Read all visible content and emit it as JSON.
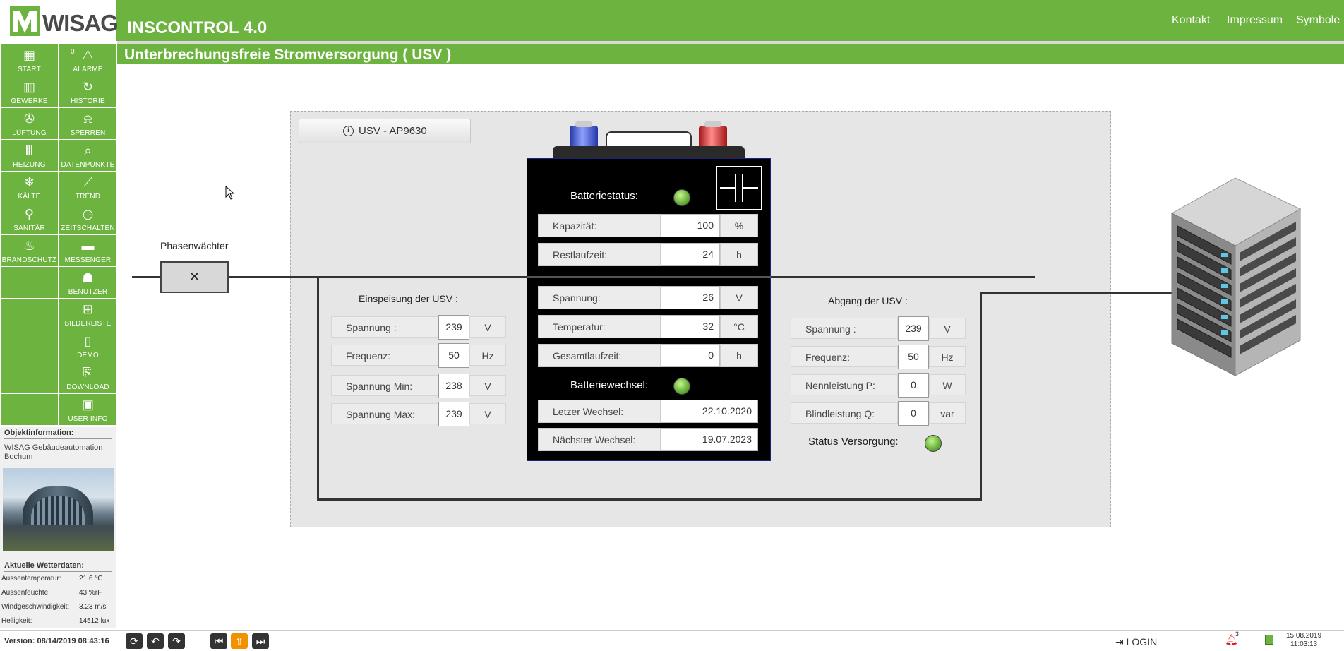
{
  "header": {
    "logo_text": "WISAG",
    "app_title": "INSCONTROL 4.0",
    "links": [
      "Kontakt",
      "Impressum",
      "Symbole"
    ]
  },
  "page_title": "Unterbrechungsfreie Stromversorgung ( USV )",
  "nav": {
    "left": [
      {
        "label": "START",
        "icon": "grid-icon"
      },
      {
        "label": "GEWERKE",
        "icon": "building-icon"
      },
      {
        "label": "LÜFTUNG",
        "icon": "fan-icon"
      },
      {
        "label": "HEIZUNG",
        "icon": "radiator-icon"
      },
      {
        "label": "KÄLTE",
        "icon": "snowflake-icon"
      },
      {
        "label": "SANITÄR",
        "icon": "faucet-icon"
      },
      {
        "label": "BRANDSCHUTZ",
        "icon": "flame-icon"
      }
    ],
    "right": [
      {
        "label": "ALARME",
        "icon": "alarm-icon"
      },
      {
        "label": "HISTORIE",
        "icon": "history-icon"
      },
      {
        "label": "SPERREN",
        "icon": "bell-off-icon"
      },
      {
        "label": "DATENPUNKTE",
        "icon": "search-chart-icon"
      },
      {
        "label": "TREND",
        "icon": "trend-icon"
      },
      {
        "label": "ZEITSCHALTEN",
        "icon": "clock-icon"
      },
      {
        "label": "MESSENGER",
        "icon": "chat-icon"
      },
      {
        "label": "BENUTZER",
        "icon": "users-icon"
      },
      {
        "label": "BILDERLISTE",
        "icon": "sitemap-icon"
      },
      {
        "label": "DEMO",
        "icon": "door-icon"
      },
      {
        "label": "DOWNLOAD",
        "icon": "download-icon"
      },
      {
        "label": "USER INFO",
        "icon": "id-card-icon"
      }
    ],
    "alarm_count": "0"
  },
  "object_info": {
    "title": "Objektinformation:",
    "text": "WISAG Gebäudeautomation Bochum"
  },
  "weather": {
    "title": "Aktuelle Wetterdaten:",
    "rows": [
      {
        "key": "Aussentemperatur:",
        "value": "21.6 °C"
      },
      {
        "key": "Aussenfeuchte:",
        "value": "43 %rF"
      },
      {
        "key": "Windgeschwindigkeit:",
        "value": "3.23 m/s"
      },
      {
        "key": "Helligkeit:",
        "value": "14512 lux"
      }
    ]
  },
  "device_button": "USV - AP9630",
  "phase_guard": {
    "label": "Phasenwächter",
    "symbol": "✕"
  },
  "input": {
    "title": "Einspeisung der USV :",
    "rows": [
      {
        "label": "Spannung :",
        "value": "239",
        "unit": "V"
      },
      {
        "label": "Frequenz:",
        "value": "50",
        "unit": "Hz"
      },
      {
        "label": "Spannung Min:",
        "value": "238",
        "unit": "V"
      },
      {
        "label": "Spannung Max:",
        "value": "239",
        "unit": "V"
      }
    ]
  },
  "battery": {
    "status_title": "Batteriestatus:",
    "status_rows": [
      {
        "label": "Kapazität:",
        "value": "100",
        "unit": "%"
      },
      {
        "label": "Restlaufzeit:",
        "value": "24",
        "unit": "h"
      }
    ],
    "rows": [
      {
        "label": "Spannung:",
        "value": "26",
        "unit": "V"
      },
      {
        "label": "Temperatur:",
        "value": "32",
        "unit": "°C"
      },
      {
        "label": "Gesamtlaufzeit:",
        "value": "0",
        "unit": "h"
      }
    ],
    "change_title": "Batteriewechsel:",
    "change_rows": [
      {
        "label": "Letzer Wechsel:",
        "value": "22.10.2020"
      },
      {
        "label": "Nächster Wechsel:",
        "value": "19.07.2023"
      }
    ]
  },
  "output": {
    "title": "Abgang der USV :",
    "rows": [
      {
        "label": "Spannung :",
        "value": "239",
        "unit": "V"
      },
      {
        "label": "Frequenz:",
        "value": "50",
        "unit": "Hz"
      },
      {
        "label": "Nennleistung P:",
        "value": "0",
        "unit": "W"
      },
      {
        "label": "Blindleistung Q:",
        "value": "0",
        "unit": "var"
      }
    ],
    "status_label": "Status Versorgung:"
  },
  "footer": {
    "version": "Version: 08/14/2019 08:43:16",
    "login": "LOGIN",
    "bell_count": "3",
    "date": "15.08.2019",
    "time": "11:03:13"
  },
  "colors": {
    "brand_green": "#6db33f",
    "led_green": "#6db33f",
    "battery_bg": "#000000",
    "orange_button": "#f29100"
  }
}
